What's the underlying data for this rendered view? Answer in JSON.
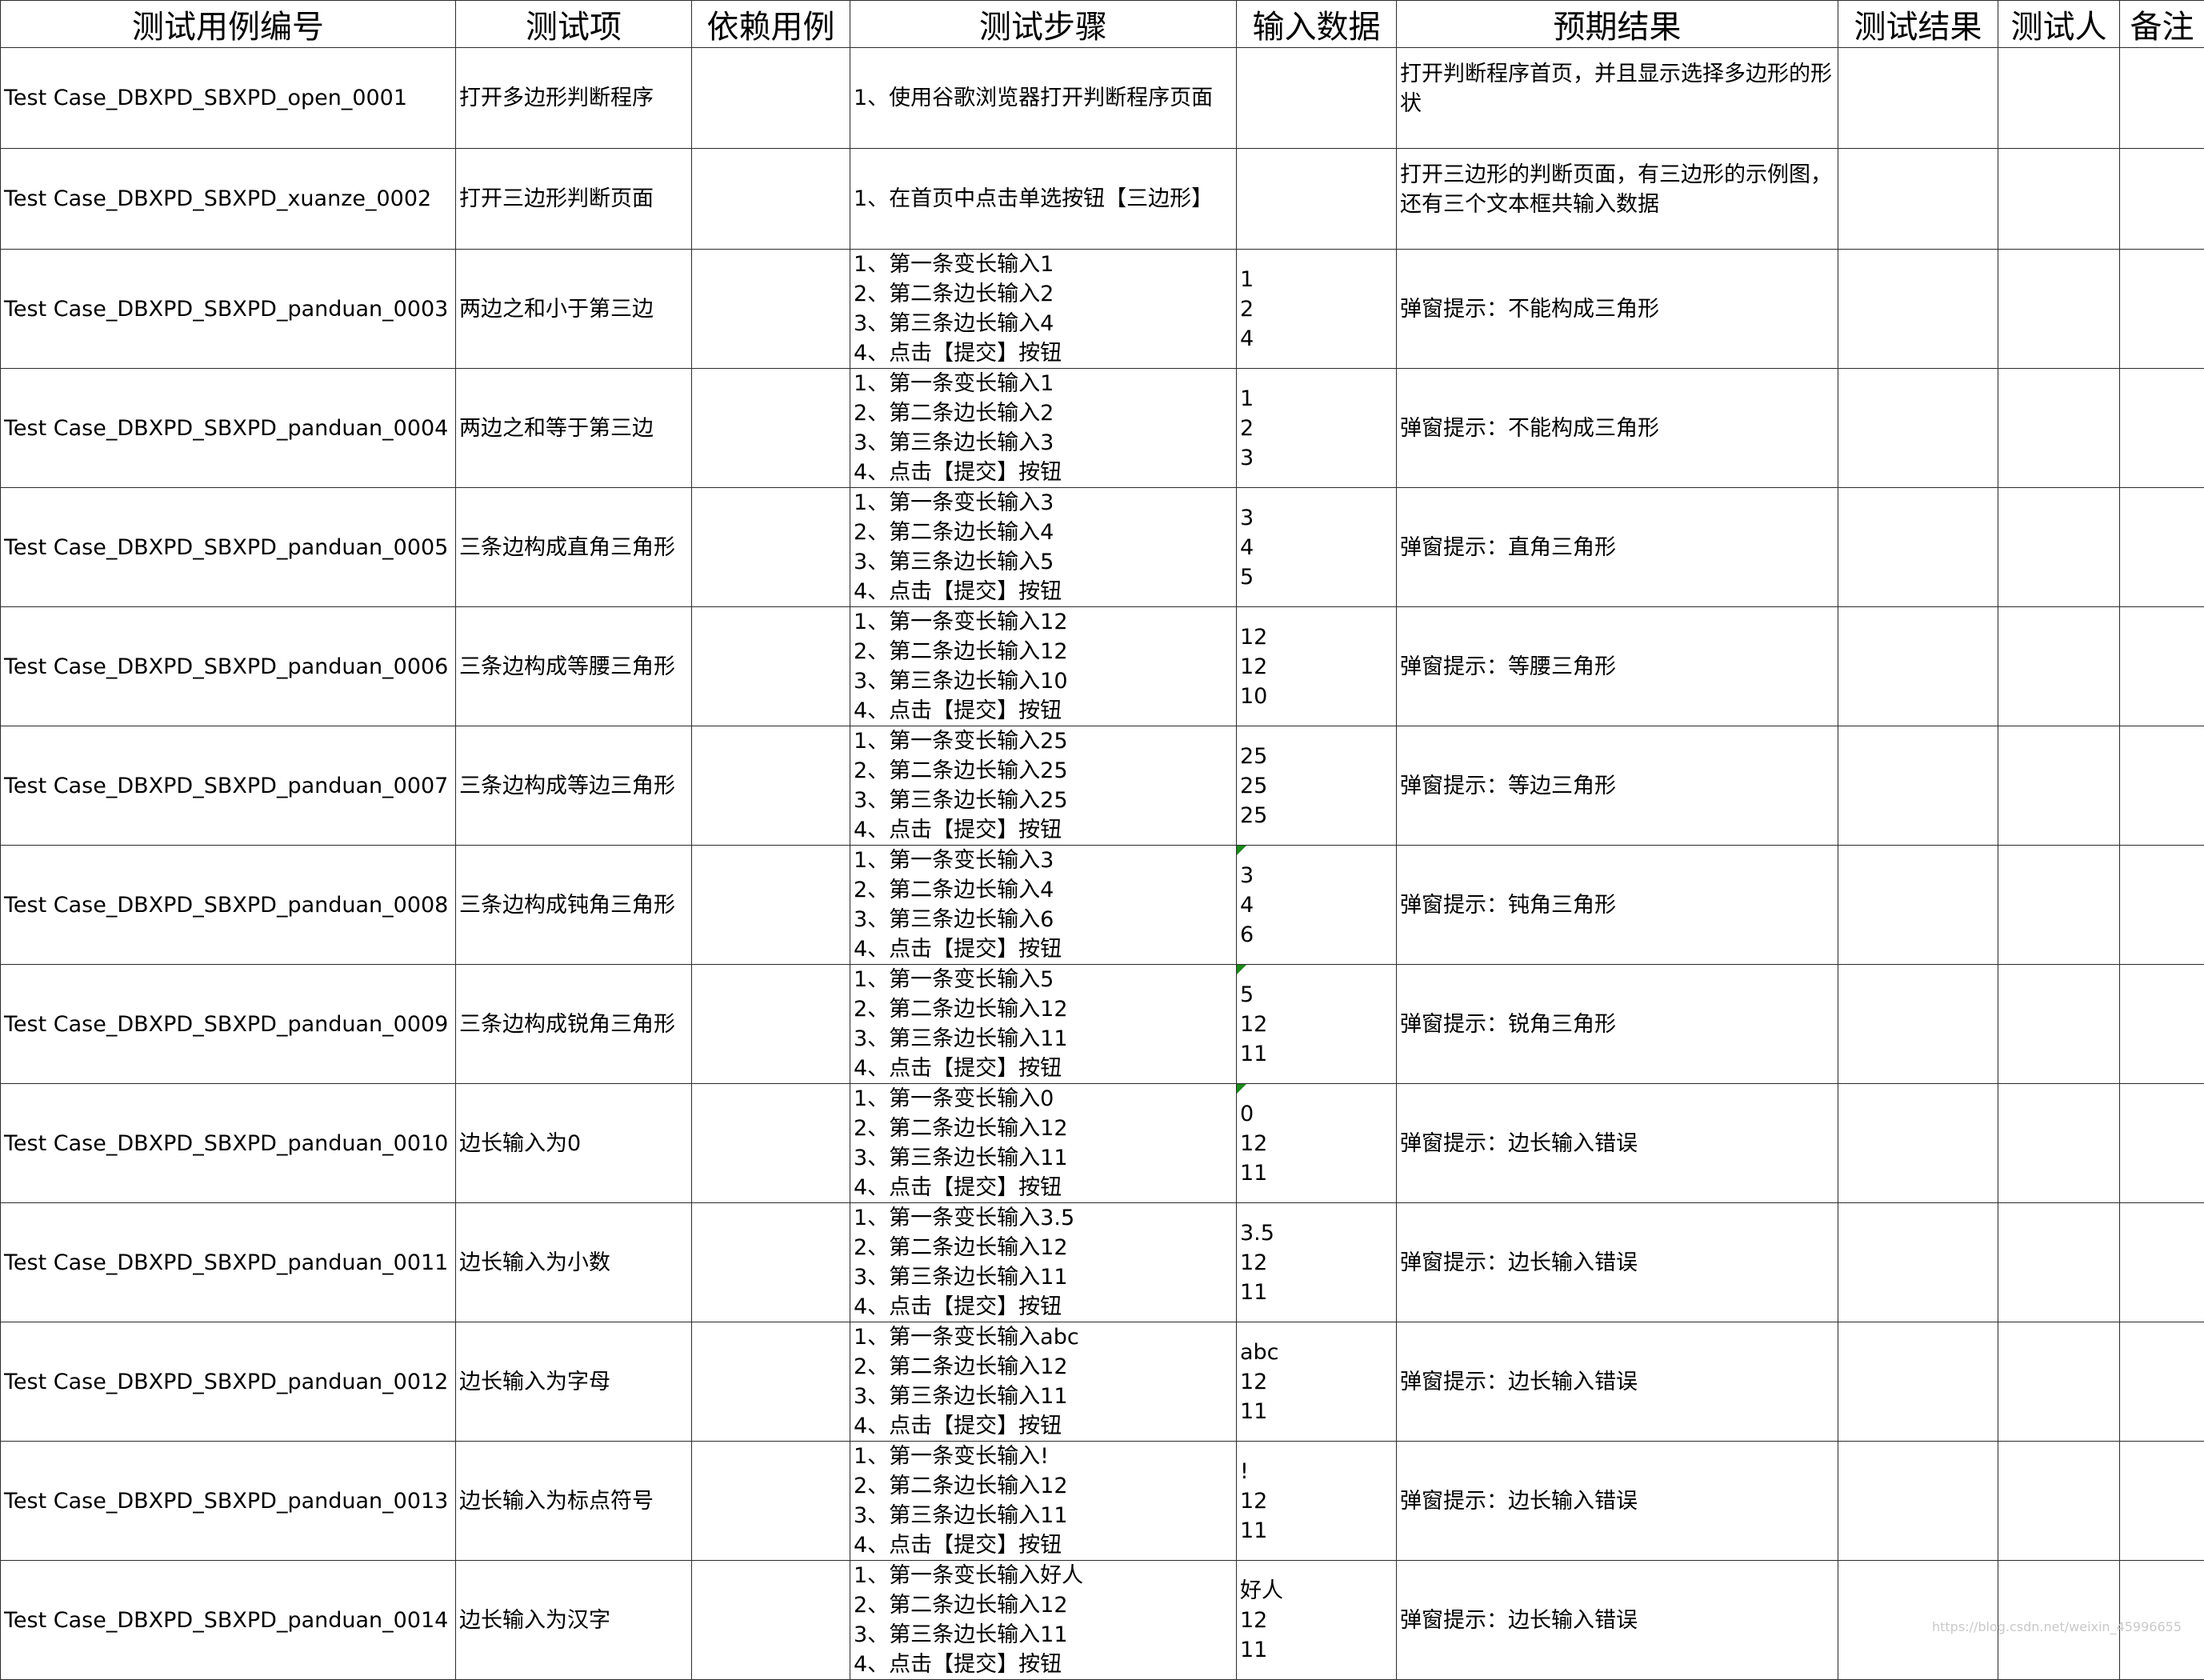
{
  "headers": [
    "测试用例编号",
    "测试项",
    "依赖用例",
    "测试步骤",
    "输入数据",
    "预期结果",
    "测试结果",
    "测试人",
    "备注"
  ],
  "rows": [
    {
      "id": "Test Case_DBXPD_SBXPD_open_0001",
      "item": "打开多边形判断程序",
      "dep": "",
      "steps": "1、使用谷歌浏览器打开判断程序页面",
      "input": "",
      "expected": "打开判断程序首页，并且显示选择多边形的形\n状",
      "result": "",
      "tester": "",
      "note": ""
    },
    {
      "id": "Test Case_DBXPD_SBXPD_xuanze_0002",
      "item": "打开三边形判断页面",
      "dep": "",
      "steps": "1、在首页中点击单选按钮【三边形】",
      "input": "",
      "expected": "打开三边形的判断页面，有三边形的示例图，\n还有三个文本框共输入数据",
      "result": "",
      "tester": "",
      "note": ""
    },
    {
      "id": "Test Case_DBXPD_SBXPD_panduan_0003",
      "item": "两边之和小于第三边",
      "dep": "",
      "steps": "1、第一条变长输入1\n2、第二条边长输入2\n3、第三条边长输入4\n4、点击【提交】按钮",
      "input": "1\n2\n4",
      "expected": "弹窗提示：不能构成三角形",
      "result": "",
      "tester": "",
      "note": ""
    },
    {
      "id": "Test Case_DBXPD_SBXPD_panduan_0004",
      "item": "两边之和等于第三边",
      "dep": "",
      "steps": "1、第一条变长输入1\n2、第二条边长输入2\n3、第三条边长输入3\n4、点击【提交】按钮",
      "input": "1\n2\n3",
      "expected": "弹窗提示：不能构成三角形",
      "result": "",
      "tester": "",
      "note": ""
    },
    {
      "id": "Test Case_DBXPD_SBXPD_panduan_0005",
      "item": "三条边构成直角三角形",
      "dep": "",
      "steps": "1、第一条变长输入3\n2、第二条边长输入4\n3、第三条边长输入5\n4、点击【提交】按钮",
      "input": "3\n4\n5",
      "expected": "弹窗提示：直角三角形",
      "result": "",
      "tester": "",
      "note": ""
    },
    {
      "id": "Test Case_DBXPD_SBXPD_panduan_0006",
      "item": "三条边构成等腰三角形",
      "dep": "",
      "steps": "1、第一条变长输入12\n2、第二条边长输入12\n3、第三条边长输入10\n4、点击【提交】按钮",
      "input": "12\n12\n10",
      "expected": "弹窗提示：等腰三角形",
      "result": "",
      "tester": "",
      "note": ""
    },
    {
      "id": "Test Case_DBXPD_SBXPD_panduan_0007",
      "item": "三条边构成等边三角形",
      "dep": "",
      "steps": "1、第一条变长输入25\n2、第二条边长输入25\n3、第三条边长输入25\n4、点击【提交】按钮",
      "input": "25\n25\n25",
      "expected": "弹窗提示：等边三角形",
      "result": "",
      "tester": "",
      "note": ""
    },
    {
      "id": "Test Case_DBXPD_SBXPD_panduan_0008",
      "item": "三条边构成钝角三角形",
      "dep": "",
      "steps": "1、第一条变长输入3\n2、第二条边长输入4\n3、第三条边长输入6\n4、点击【提交】按钮",
      "input": "3\n4\n6",
      "expected": "弹窗提示：钝角三角形",
      "result": "",
      "tester": "",
      "note": "",
      "marker": true
    },
    {
      "id": "Test Case_DBXPD_SBXPD_panduan_0009",
      "item": "三条边构成锐角三角形",
      "dep": "",
      "steps": "1、第一条变长输入5\n2、第二条边长输入12\n3、第三条边长输入11\n4、点击【提交】按钮",
      "input": "5\n12\n11",
      "expected": "弹窗提示：锐角三角形",
      "result": "",
      "tester": "",
      "note": "",
      "marker": true
    },
    {
      "id": "Test Case_DBXPD_SBXPD_panduan_0010",
      "item": "边长输入为0",
      "dep": "",
      "steps": "1、第一条变长输入0\n2、第二条边长输入12\n3、第三条边长输入11\n4、点击【提交】按钮",
      "input": "0\n12\n11",
      "expected": "弹窗提示：边长输入错误",
      "result": "",
      "tester": "",
      "note": "",
      "marker": true
    },
    {
      "id": "Test Case_DBXPD_SBXPD_panduan_0011",
      "item": "边长输入为小数",
      "dep": "",
      "steps": "1、第一条变长输入3.5\n2、第二条边长输入12\n3、第三条边长输入11\n4、点击【提交】按钮",
      "input": "3.5\n12\n11",
      "expected": "弹窗提示：边长输入错误",
      "result": "",
      "tester": "",
      "note": ""
    },
    {
      "id": "Test Case_DBXPD_SBXPD_panduan_0012",
      "item": "边长输入为字母",
      "dep": "",
      "steps": "1、第一条变长输入abc\n2、第二条边长输入12\n3、第三条边长输入11\n4、点击【提交】按钮",
      "input": "abc\n12\n11",
      "expected": "弹窗提示：边长输入错误",
      "result": "",
      "tester": "",
      "note": ""
    },
    {
      "id": "Test Case_DBXPD_SBXPD_panduan_0013",
      "item": "边长输入为标点符号",
      "dep": "",
      "steps": "1、第一条变长输入!\n2、第二条边长输入12\n3、第三条边长输入11\n4、点击【提交】按钮",
      "input": "!\n12\n11",
      "expected": "弹窗提示：边长输入错误",
      "result": "",
      "tester": "",
      "note": ""
    },
    {
      "id": "Test Case_DBXPD_SBXPD_panduan_0014",
      "item": "边长输入为汉字",
      "dep": "",
      "steps": "1、第一条变长输入好人\n2、第二条边长输入12\n3、第三条边长输入11\n4、点击【提交】按钮",
      "input": "好人\n12\n11",
      "expected": "弹窗提示：边长输入错误",
      "result": "",
      "tester": "",
      "note": ""
    }
  ],
  "watermark": "https://blog.csdn.net/weixin_45996655"
}
